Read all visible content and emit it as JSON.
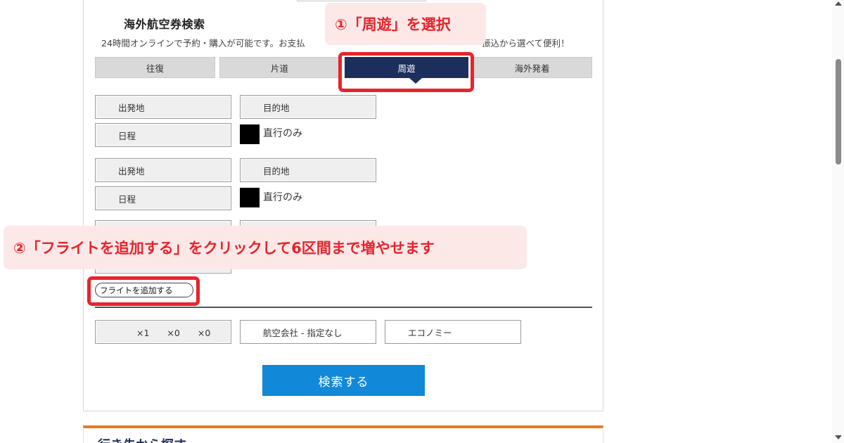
{
  "card": {
    "title": "海外航空券検索",
    "subtitle": "24時間オンラインで予約・購入が可能です。お支払いは、クレジットカード・コンビニ・銀行振込から選べて便利！",
    "subtitle_visible_left": "24時間オンラインで予約・購入が可能です。お支払",
    "subtitle_visible_right": "振込から選べて便利！"
  },
  "tabs": [
    {
      "label": "往復",
      "active": false
    },
    {
      "label": "片道",
      "active": false
    },
    {
      "label": "周遊",
      "active": true
    },
    {
      "label": "海外発着",
      "active": false
    }
  ],
  "legs": [
    {
      "origin": "出発地",
      "destination": "目的地",
      "date": "日程",
      "direct_only": "直行のみ"
    },
    {
      "origin": "出発地",
      "destination": "目的地",
      "date": "日程",
      "direct_only": "直行のみ"
    }
  ],
  "add_flight_label": "フライトを追加する",
  "options": {
    "passengers": "×1　　×0　　×0",
    "airline": "航空会社 - 指定なし",
    "cabin": "エコノミー"
  },
  "search_label": "検索する",
  "next_section_title": "行き先から探す",
  "callouts": {
    "step1": "①「周遊」を選択",
    "step2": "②「フライトを追加する」をクリックして6区間まで増やせます"
  },
  "colors": {
    "accent_navy": "#1c2f5c",
    "search_blue": "#1188d8",
    "highlight_red": "#e8242b",
    "callout_bg": "#fde8e8",
    "section_orange": "#ee7a1a"
  }
}
